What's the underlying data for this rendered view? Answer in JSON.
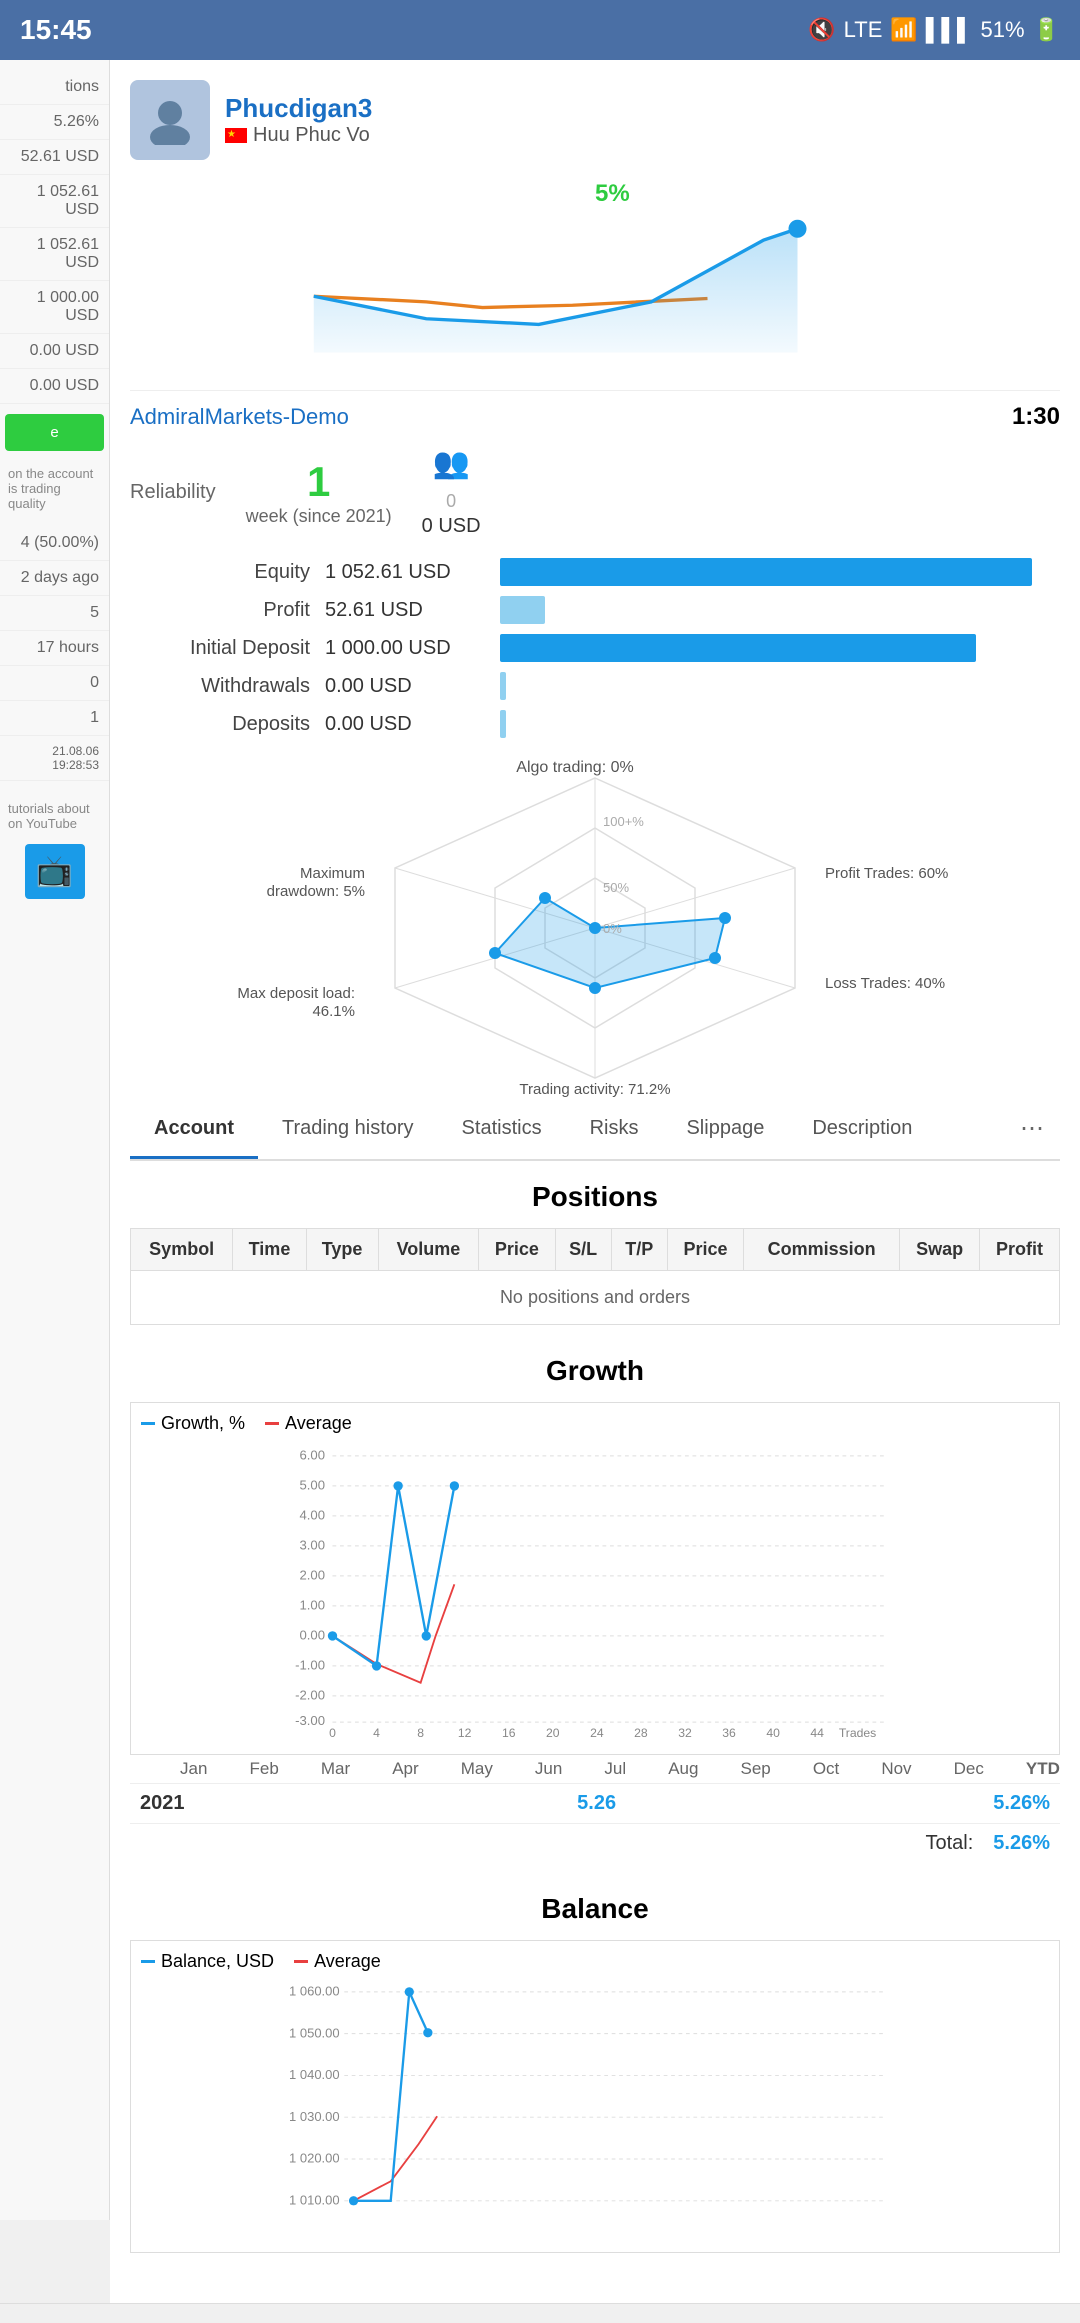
{
  "statusBar": {
    "time": "15:45",
    "battery": "51%"
  },
  "profile": {
    "username": "Phucdigan3",
    "realname": "Huu Phuc Vo",
    "growth": "5%"
  },
  "account": {
    "name": "AdmiralMarkets-Demo",
    "leverage": "1:30",
    "reliability": "1",
    "reliabilitySub": "week (since 2021)",
    "followersCount": "0",
    "followersUSD": "0 USD"
  },
  "equity": {
    "equityLabel": "Equity",
    "equityValue": "1 052.61 USD",
    "profitLabel": "Profit",
    "profitValue": "52.61 USD",
    "initialDepositLabel": "Initial Deposit",
    "initialDepositValue": "1 000.00 USD",
    "withdrawalsLabel": "Withdrawals",
    "withdrawalsValue": "0.00 USD",
    "depositsLabel": "Deposits",
    "depositsValue": "0.00 USD"
  },
  "radar": {
    "algoTrading": "Algo trading: 0%",
    "maxDrawdown": "Maximum drawdown: 5%",
    "profitTrades": "Profit Trades: 60%",
    "lossTrades": "Loss Trades: 40%",
    "maxDepositLoad": "Max deposit load: 46.1%",
    "tradingActivity": "Trading activity: 71.2%",
    "scale100": "100+%",
    "scale50": "50%",
    "scale0": "0%"
  },
  "tabs": [
    {
      "label": "Account",
      "active": true
    },
    {
      "label": "Trading history",
      "active": false
    },
    {
      "label": "Statistics",
      "active": false
    },
    {
      "label": "Risks",
      "active": false
    },
    {
      "label": "Slippage",
      "active": false
    },
    {
      "label": "Description",
      "active": false
    }
  ],
  "positions": {
    "title": "Positions",
    "emptyMessage": "No positions and orders",
    "columns": [
      "Symbol",
      "Time",
      "Type",
      "Volume",
      "Price",
      "S/L",
      "T/P",
      "Price",
      "Commission",
      "Swap",
      "Profit"
    ]
  },
  "growthChart": {
    "title": "Growth",
    "legend": [
      "Growth, %",
      "Average"
    ],
    "yLabels": [
      "6.00",
      "5.00",
      "4.00",
      "3.00",
      "2.00",
      "1.00",
      "0.00",
      "-1.00",
      "-2.00",
      "-3.00"
    ],
    "xLabels": [
      "0",
      "4",
      "8",
      "12",
      "16",
      "20",
      "24",
      "28",
      "32",
      "36",
      "40",
      "44"
    ],
    "monthLabels": [
      "Jan",
      "Feb",
      "Mar",
      "Apr",
      "May",
      "Jun",
      "Jul",
      "Aug",
      "Sep",
      "Oct",
      "Nov",
      "Dec",
      "YTD"
    ],
    "tradesLabel": "Trades"
  },
  "yearData": {
    "year": "2021",
    "value": "5.26",
    "ytd": "5.26%",
    "totalLabel": "Total:",
    "totalValue": "5.26%"
  },
  "balanceChart": {
    "title": "Balance",
    "legend": [
      "Balance, USD",
      "Average"
    ],
    "yLabels": [
      "1 060.00",
      "1 050.00",
      "1 040.00",
      "1 030.00",
      "1 020.00",
      "1 010.00"
    ]
  },
  "sidebar": {
    "items": [
      "5.26%",
      "52.61 USD",
      "1 052.61 USD",
      "1 052.61 USD",
      "1 000.00 USD",
      "0.00 USD",
      "0.00 USD"
    ],
    "note1": "on the account is trading quality",
    "stats": [
      "4 (50.00%)",
      "2 days ago",
      "5",
      "17 hours",
      "0",
      "1",
      "21.08.06 19:28:53"
    ],
    "note2": "tutorials about on YouTube"
  }
}
